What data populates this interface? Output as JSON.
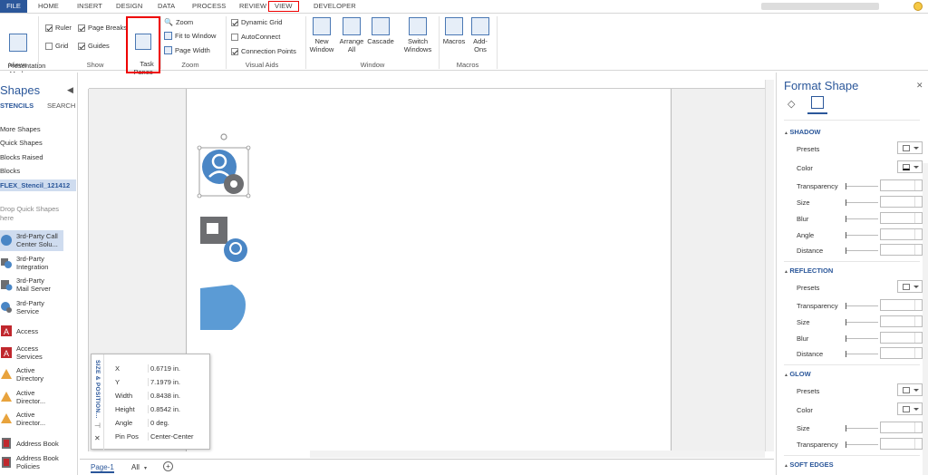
{
  "tabs": {
    "file": "FILE",
    "items": [
      "HOME",
      "INSERT",
      "DESIGN",
      "DATA",
      "PROCESS",
      "REVIEW",
      "VIEW",
      "DEVELOPER"
    ]
  },
  "ribbon": {
    "views": {
      "label": "Views",
      "presentation": "Presentation\nMode"
    },
    "show": {
      "label": "Show",
      "ruler": "Ruler",
      "page_breaks": "Page Breaks",
      "grid": "Grid",
      "guides": "Guides",
      "task_panes": "Task\nPanes"
    },
    "zoom": {
      "label": "Zoom",
      "zoom": "Zoom",
      "fit_to_window": "Fit to Window",
      "page_width": "Page Width"
    },
    "visual_aids": {
      "label": "Visual Aids",
      "dynamic_grid": "Dynamic Grid",
      "autoconnect": "AutoConnect",
      "connection_points": "Connection Points"
    },
    "window": {
      "label": "Window",
      "new_window": "New\nWindow",
      "arrange_all": "Arrange\nAll",
      "cascade": "Cascade",
      "switch_windows": "Switch\nWindows"
    },
    "macros": {
      "label": "Macros",
      "macros": "Macros",
      "addons": "Add-\nOns"
    }
  },
  "shapes_panel": {
    "title": "Shapes",
    "tab_stencils": "STENCILS",
    "tab_search": "SEARCH",
    "more_shapes": "More Shapes",
    "quick_shapes": "Quick Shapes",
    "blocks_raised": "Blocks Raised",
    "blocks": "Blocks",
    "stencil": "FLEX_Stencil_121412",
    "drop_hint": "Drop Quick Shapes\nhere",
    "shapes": [
      "3rd-Party Call\nCenter Solu...",
      "3rd-Party\nIntegration",
      "3rd-Party\nMail Server",
      "3rd-Party\nService",
      "Access",
      "Access\nServices",
      "Active\nDirectory",
      "Active\nDirector...",
      "Active\nDirector...",
      "Address Book",
      "Address Book\nPolicies"
    ]
  },
  "size_position": {
    "title": "SIZE & POSITION...",
    "rows": [
      {
        "key": "X",
        "value": "0.6719 in."
      },
      {
        "key": "Y",
        "value": "7.1979 in."
      },
      {
        "key": "Width",
        "value": "0.8438 in."
      },
      {
        "key": "Height",
        "value": "0.8542 in."
      },
      {
        "key": "Angle",
        "value": "0 deg."
      },
      {
        "key": "Pin Pos",
        "value": "Center-Center"
      }
    ]
  },
  "bottom": {
    "page": "Page-1",
    "all": "All"
  },
  "format_shape": {
    "title": "Format Shape",
    "shadow": {
      "label": "SHADOW",
      "props": [
        "Presets",
        "Color",
        "Transparency",
        "Size",
        "Blur",
        "Angle",
        "Distance"
      ]
    },
    "reflection": {
      "label": "REFLECTION",
      "props": [
        "Presets",
        "Transparency",
        "Size",
        "Blur",
        "Distance"
      ]
    },
    "glow": {
      "label": "GLOW",
      "props": [
        "Presets",
        "Color",
        "Size",
        "Transparency"
      ]
    },
    "soft_edges": {
      "label": "SOFT EDGES"
    }
  },
  "colors": {
    "accent": "#2b579a",
    "shape_blue": "#4a86c5",
    "shape_gray": "#6d6e71",
    "highlight": "#ee0000"
  }
}
